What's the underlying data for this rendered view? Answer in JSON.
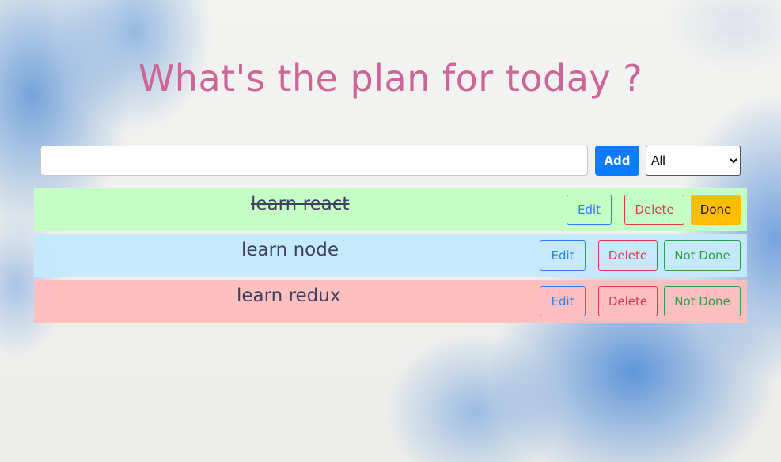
{
  "header": {
    "title": "What's the plan for today ?"
  },
  "form": {
    "input_value": "",
    "input_placeholder": "",
    "add_label": "Add",
    "filter_selected": "All",
    "filter_options": [
      "All"
    ]
  },
  "todos": [
    {
      "text": "learn react",
      "completed": true,
      "row_color": "#c4ffc4",
      "edit_label": "Edit",
      "delete_label": "Delete",
      "toggle_label": "Done"
    },
    {
      "text": "learn node",
      "completed": false,
      "row_color": "#c4e8fc",
      "edit_label": "Edit",
      "delete_label": "Delete",
      "toggle_label": "Not Done"
    },
    {
      "text": "learn redux",
      "completed": false,
      "row_color": "#ffbebe",
      "edit_label": "Edit",
      "delete_label": "Delete",
      "toggle_label": "Not Done"
    }
  ],
  "colors": {
    "title": "#cc6598",
    "add_button": "#0a7cff",
    "edit": "#2f7ff5",
    "delete": "#dc3a4d",
    "not_done": "#2c9e4a",
    "done": "#ffbd00"
  }
}
